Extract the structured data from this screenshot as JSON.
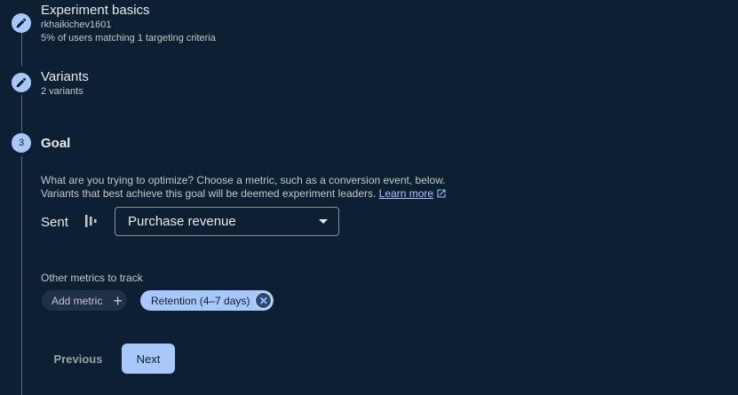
{
  "steps": [
    {
      "title": "Experiment basics",
      "line1": "rkhaikichev1601",
      "line2": "5% of users matching 1 targeting criteria",
      "icon": "pencil-icon"
    },
    {
      "title": "Variants",
      "line1": "2 variants",
      "icon": "pencil-icon"
    },
    {
      "number": "3",
      "title": "Goal"
    }
  ],
  "goal": {
    "description_line1": "What are you trying to optimize? Choose a metric, such as a conversion event, below.",
    "description_line2": "Variants that best achieve this goal will be deemed experiment leaders.",
    "learn_more": "Learn more",
    "sent_label": "Sent",
    "selected_metric": "Purchase revenue",
    "other_metrics_label": "Other metrics to track",
    "add_metric": "Add metric",
    "selected_chips": [
      "Retention (4–7 days)"
    ]
  },
  "buttons": {
    "previous": "Previous",
    "next": "Next"
  }
}
